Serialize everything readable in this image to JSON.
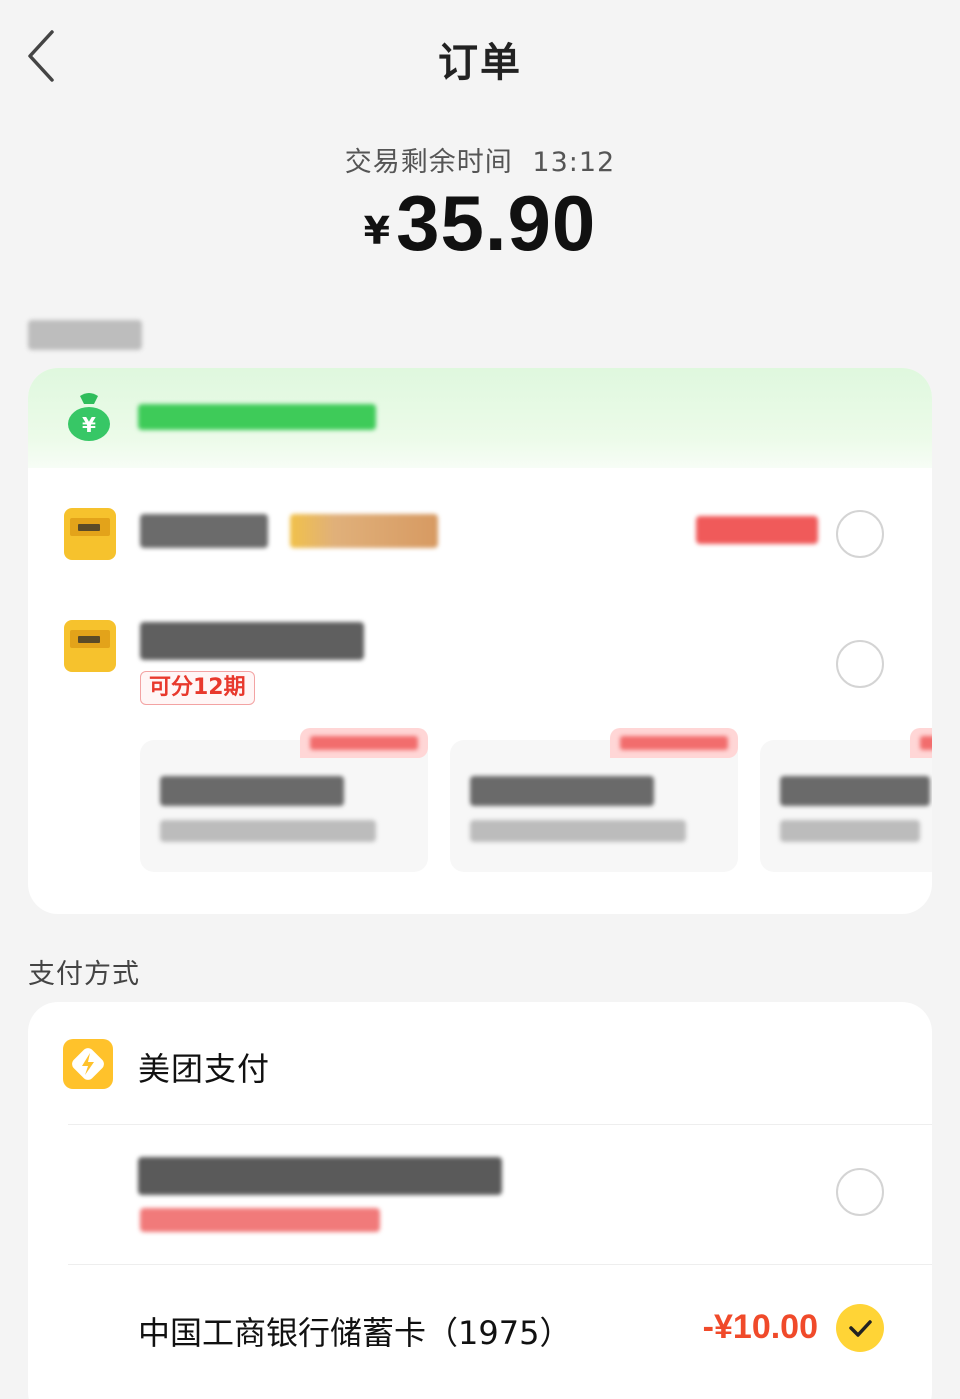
{
  "header": {
    "title": "订单",
    "back_icon": "chevron-left-icon"
  },
  "summary": {
    "timer_label": "交易剩余时间",
    "timer_value": "13:12",
    "currency": "¥",
    "amount": "35.90"
  },
  "installment_option": {
    "badge": "可分12期"
  },
  "payment_section": {
    "label": "支付方式",
    "provider": "美团支付",
    "provider_icon": "meituan-pay-icon",
    "selected_card": {
      "name": "中国工商银行储蓄卡（1975）",
      "deduction": "-¥10.00",
      "check_icon": "checkmark-icon"
    }
  },
  "colors": {
    "background": "#f4f4f4",
    "accent_yellow": "#ffd436",
    "price_red": "#f04a2a",
    "promo_green": "#3ecb59"
  }
}
